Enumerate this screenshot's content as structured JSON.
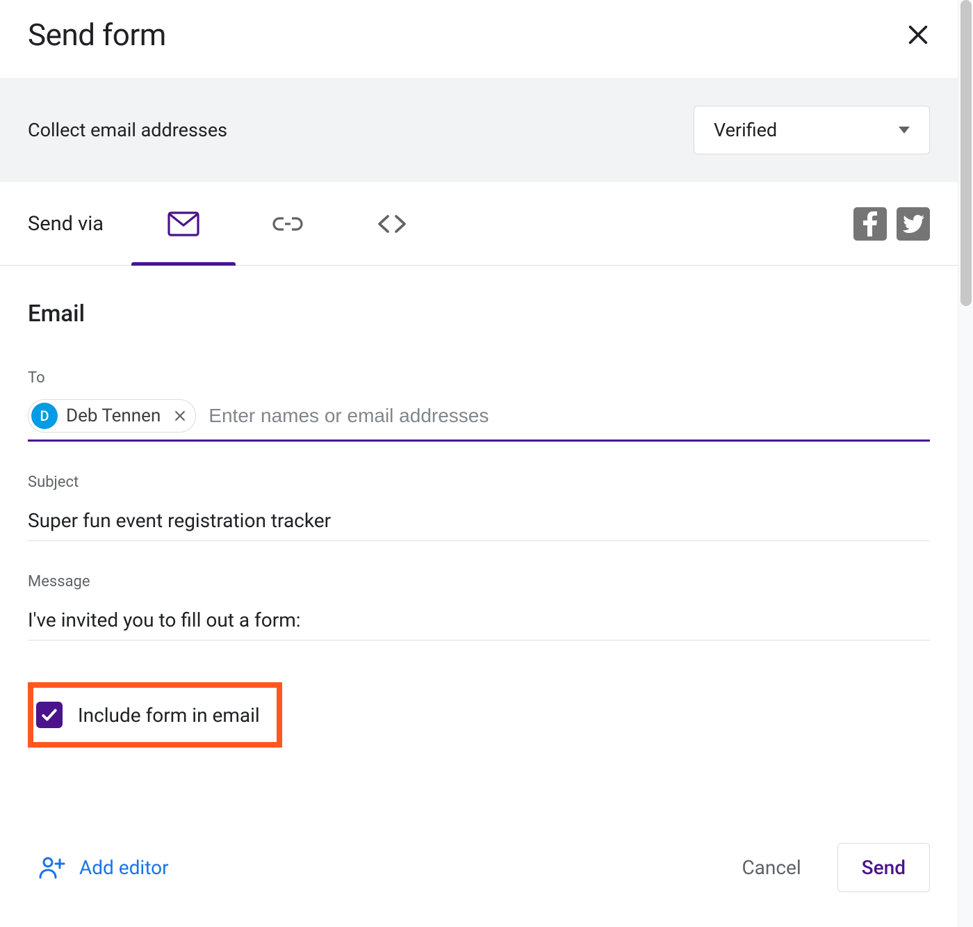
{
  "dialog": {
    "title": "Send form"
  },
  "collect": {
    "label": "Collect email addresses",
    "selected": "Verified"
  },
  "sendvia": {
    "label": "Send via"
  },
  "email": {
    "section_title": "Email",
    "to_label": "To",
    "to_placeholder": "Enter names or email addresses",
    "recipient": {
      "initial": "D",
      "name": "Deb Tennen"
    },
    "subject_label": "Subject",
    "subject_value": "Super fun event registration tracker",
    "message_label": "Message",
    "message_value": "I've invited you to fill out a form:",
    "include_label": "Include form in email",
    "include_checked": true
  },
  "footer": {
    "add_editor": "Add editor",
    "cancel": "Cancel",
    "send": "Send"
  },
  "colors": {
    "accent": "#4a148c",
    "link_blue": "#1a73e8",
    "highlight_border": "#ff5722",
    "chip_avatar": "#039be5"
  }
}
